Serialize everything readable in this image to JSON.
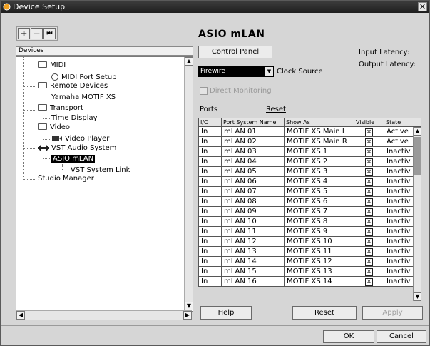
{
  "window": {
    "title": "Device Setup",
    "close_glyph": "✕"
  },
  "toolbar": {
    "add": "+",
    "remove": "−",
    "reset": "⏮"
  },
  "tree": {
    "header": "Devices",
    "nodes": [
      {
        "label": "MIDI",
        "icon": "folder-icon"
      },
      {
        "label": "MIDI Port Setup",
        "icon": "radio-icon"
      },
      {
        "label": "Remote Devices",
        "icon": "folder-icon"
      },
      {
        "label": "Yamaha MOTIF XS",
        "icon": ""
      },
      {
        "label": "Transport",
        "icon": "folder-icon"
      },
      {
        "label": "Time Display",
        "icon": ""
      },
      {
        "label": "Video",
        "icon": "folder-icon"
      },
      {
        "label": "Video Player",
        "icon": "video-icon"
      },
      {
        "label": "VST Audio System",
        "icon": "audio-icon"
      },
      {
        "label": "ASIO mLAN",
        "icon": "",
        "selected": true
      },
      {
        "label": "VST System Link",
        "icon": ""
      },
      {
        "label": "Studio Manager",
        "icon": ""
      }
    ]
  },
  "panel": {
    "title": "ASIO mLAN",
    "control_panel": "Control Panel",
    "input_latency": "Input Latency:",
    "output_latency": "Output Latency:",
    "clock_source_value": "Firewire",
    "clock_source_label": "Clock Source",
    "direct_monitoring": "Direct Monitoring",
    "ports_label": "Ports",
    "reset_link": "Reset"
  },
  "ports_table": {
    "headers": [
      "I/O",
      "Port System Name",
      "Show As",
      "Visible",
      "State"
    ],
    "rows": [
      [
        "In",
        "mLAN 01",
        "MOTIF XS Main L",
        "✕",
        "Active"
      ],
      [
        "In",
        "mLAN 02",
        "MOTIF XS Main R",
        "✕",
        "Active"
      ],
      [
        "In",
        "mLAN 03",
        "MOTIF XS 1",
        "✕",
        "Inactiv"
      ],
      [
        "In",
        "mLAN 04",
        "MOTIF XS 2",
        "✕",
        "Inactiv"
      ],
      [
        "In",
        "mLAN 05",
        "MOTIF XS 3",
        "✕",
        "Inactiv"
      ],
      [
        "In",
        "mLAN 06",
        "MOTIF XS 4",
        "✕",
        "Inactiv"
      ],
      [
        "In",
        "mLAN 07",
        "MOTIF XS 5",
        "✕",
        "Inactiv"
      ],
      [
        "In",
        "mLAN 08",
        "MOTIF XS 6",
        "✕",
        "Inactiv"
      ],
      [
        "In",
        "mLAN 09",
        "MOTIF XS 7",
        "✕",
        "Inactiv"
      ],
      [
        "In",
        "mLAN 10",
        "MOTIF XS 8",
        "✕",
        "Inactiv"
      ],
      [
        "In",
        "mLAN 11",
        "MOTIF XS 9",
        "✕",
        "Inactiv"
      ],
      [
        "In",
        "mLAN 12",
        "MOTIF XS 10",
        "✕",
        "Inactiv"
      ],
      [
        "In",
        "mLAN 13",
        "MOTIF XS 11",
        "✕",
        "Inactiv"
      ],
      [
        "In",
        "mLAN 14",
        "MOTIF XS 12",
        "✕",
        "Inactiv"
      ],
      [
        "In",
        "mLAN 15",
        "MOTIF XS 13",
        "✕",
        "Inactiv"
      ],
      [
        "In",
        "mLAN 16",
        "MOTIF XS 14",
        "✕",
        "Inactiv"
      ]
    ]
  },
  "buttons": {
    "help": "Help",
    "reset": "Reset",
    "apply": "Apply",
    "ok": "OK",
    "cancel": "Cancel"
  }
}
